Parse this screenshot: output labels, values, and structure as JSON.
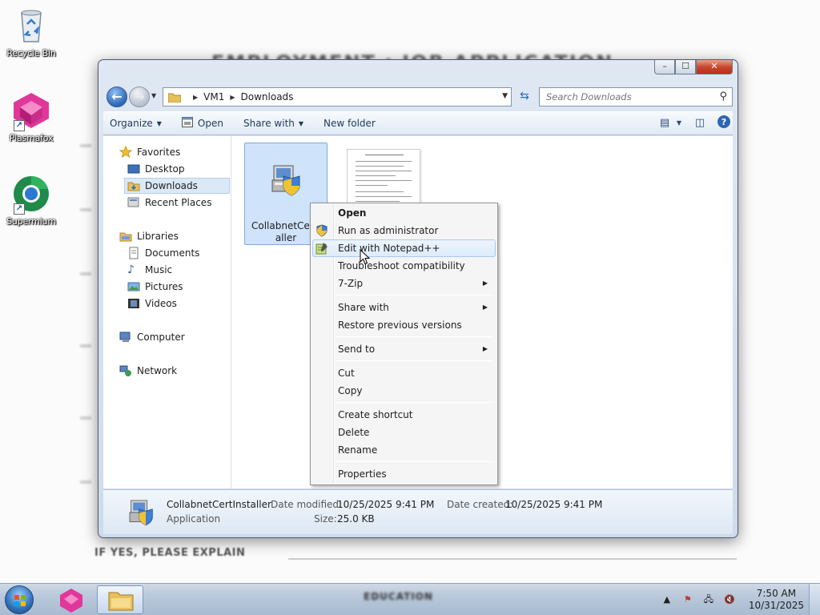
{
  "desktop": {
    "background_heading": "EMPLOYMENT : JOB APPLICATION",
    "background_footer": "IF YES, PLEASE EXPLAIN",
    "icons": [
      {
        "label": "Recycle Bin",
        "icon": "recycle-bin-icon"
      },
      {
        "label": "Plasmafox",
        "icon": "plasmafox-icon"
      },
      {
        "label": "Supermium",
        "icon": "supermium-icon"
      }
    ]
  },
  "window": {
    "controls": {
      "minimize": "–",
      "maximize": "☐",
      "close": "✕"
    },
    "address": {
      "crumbs": [
        "VM1",
        "Downloads"
      ]
    },
    "search": {
      "placeholder": "Search Downloads"
    },
    "toolbar": {
      "organize": "Organize",
      "open": "Open",
      "share_with": "Share with",
      "new_folder": "New folder"
    },
    "nav": {
      "favorites": "Favorites",
      "desktop": "Desktop",
      "downloads": "Downloads",
      "recent_places": "Recent Places",
      "libraries": "Libraries",
      "documents": "Documents",
      "music": "Music",
      "pictures": "Pictures",
      "videos": "Videos",
      "computer": "Computer",
      "network": "Network"
    },
    "files": [
      {
        "name_line1": "CollabnetCertI",
        "name_line2": "aller",
        "icon": "installer-icon",
        "selected": true
      },
      {
        "name": "",
        "icon": "document-thumbnail",
        "selected": false
      }
    ],
    "details": {
      "name": "CollabnetCertInstaller",
      "type": "Application",
      "date_modified_label": "Date modified:",
      "date_modified": "10/25/2025 9:41 PM",
      "date_created_label": "Date created:",
      "date_created": "10/25/2025 9:41 PM",
      "size_label": "Size:",
      "size": "25.0 KB"
    }
  },
  "context_menu": {
    "items": [
      {
        "label": "Open",
        "bold": true
      },
      {
        "label": "Run as administrator",
        "icon": "shield-icon"
      },
      {
        "label": "Edit with Notepad++",
        "icon": "notepadpp-icon",
        "hover": true
      },
      {
        "label": "Troubleshoot compatibility"
      },
      {
        "label": "7-Zip",
        "submenu": true
      },
      {
        "label": "Share with",
        "submenu": true
      },
      {
        "label": "Restore previous versions"
      },
      {
        "label": "Send to",
        "submenu": true
      },
      {
        "label": "Cut"
      },
      {
        "label": "Copy"
      },
      {
        "label": "Create shortcut"
      },
      {
        "label": "Delete"
      },
      {
        "label": "Rename"
      },
      {
        "label": "Properties"
      }
    ]
  },
  "taskbar": {
    "blurred_text": "EDUCATION",
    "clock": {
      "time": "7:50 AM",
      "date": "10/31/2025"
    }
  },
  "colors": {
    "selection": "#cfe3fb",
    "window_frame": "#cddbea",
    "taskbar": "#b9c8da"
  }
}
